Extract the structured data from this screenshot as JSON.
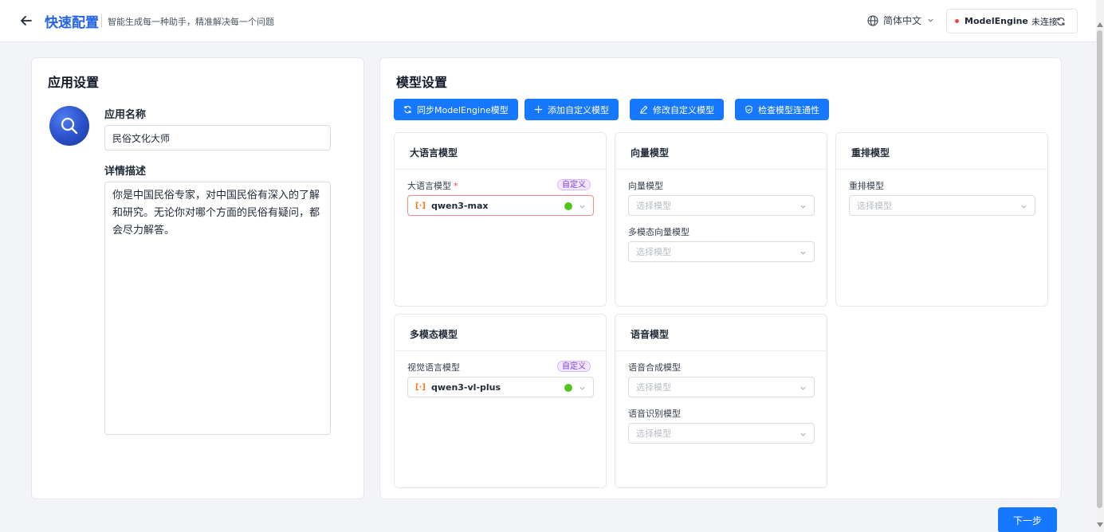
{
  "header": {
    "title": "快速配置",
    "subtitle": "智能生成每一种助手，精准解决每一个问题",
    "language": "简体中文",
    "status_name": "ModelEngine",
    "status_text": "未连接"
  },
  "app_settings": {
    "title": "应用设置",
    "name_label": "应用名称",
    "name_value": "民俗文化大师",
    "desc_label": "详情描述",
    "desc_value": "你是中国民俗专家，对中国民俗有深入的了解和研究。无论你对哪个方面的民俗有疑问，都会尽力解答。"
  },
  "model_settings": {
    "title": "模型设置",
    "buttons": {
      "sync": "同步ModelEngine模型",
      "add": "添加自定义模型",
      "edit": "修改自定义模型",
      "check": "检查模型连通性"
    },
    "placeholder": "选择模型",
    "custom_tag": "自定义",
    "llm": {
      "title": "大语言模型",
      "label": "大语言模型",
      "required": "*",
      "value": "qwen3-max"
    },
    "embedding": {
      "title": "向量模型",
      "label": "向量模型",
      "multi_label": "多模态向量模型"
    },
    "rerank": {
      "title": "重排模型",
      "label": "重排模型"
    },
    "multimodal": {
      "title": "多模态模型",
      "label": "视觉语言模型",
      "value": "qwen3-vl-plus"
    },
    "voice": {
      "title": "语音模型",
      "tts_label": "语音合成模型",
      "asr_label": "语音识别模型"
    }
  },
  "next_button": "下一步",
  "colors": {
    "primary": "#1677ff",
    "title_blue": "#2563eb",
    "error": "#ef4444",
    "ok": "#52c41a"
  }
}
